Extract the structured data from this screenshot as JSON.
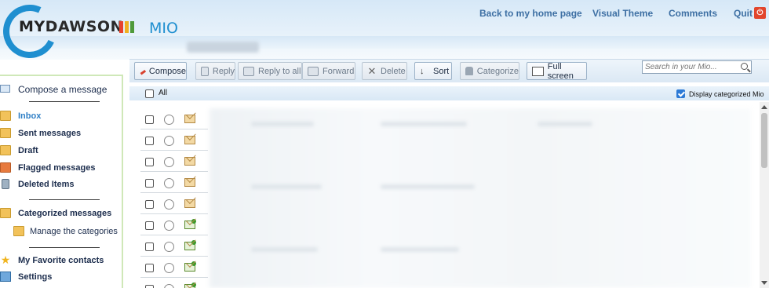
{
  "header": {
    "logo_my": "MY",
    "logo_dawson": "DAWSON",
    "logo_mio": "MIO",
    "logo_bar_colors": [
      "#e7432d",
      "#f0b020",
      "#4f9a3a"
    ],
    "links": {
      "home": "Back to my home page",
      "theme": "Visual Theme",
      "comments": "Comments",
      "quit": "Quit"
    },
    "quit_icon": "power-icon"
  },
  "sidebar": {
    "compose": "Compose a message",
    "items": [
      {
        "label": "Inbox",
        "icon": "inbox-folder-icon"
      },
      {
        "label": "Sent messages",
        "icon": "sent-folder-icon"
      },
      {
        "label": "Draft",
        "icon": "draft-folder-icon"
      },
      {
        "label": "Flagged messages",
        "icon": "flagged-folder-icon"
      },
      {
        "label": "Deleted Items",
        "icon": "trash-icon"
      }
    ],
    "categorized": "Categorized messages",
    "manage_categories": "Manage the categories",
    "favorite_contacts": "My Favorite contacts",
    "settings": "Settings"
  },
  "toolbar": {
    "compose": "Compose",
    "reply": "Reply",
    "reply_all": "Reply to all",
    "forward": "Forward",
    "delete": "Delete",
    "sort": "Sort",
    "categorize": "Categorize",
    "full_screen": "Full screen",
    "search_placeholder": "Search in your Mio..."
  },
  "list": {
    "all_label": "All",
    "display_categorized": "Display categorized Mio",
    "display_categorized_checked": true,
    "rows": [
      {
        "status": "unread"
      },
      {
        "status": "unread"
      },
      {
        "status": "unread"
      },
      {
        "status": "unread"
      },
      {
        "status": "unread"
      },
      {
        "status": "read"
      },
      {
        "status": "read"
      },
      {
        "status": "read"
      },
      {
        "status": "read"
      }
    ]
  },
  "colors": {
    "accent": "#1f8fd0",
    "link": "#3d6fa3",
    "sidebar_border": "#cfe8b8",
    "quit": "#e2462d"
  }
}
